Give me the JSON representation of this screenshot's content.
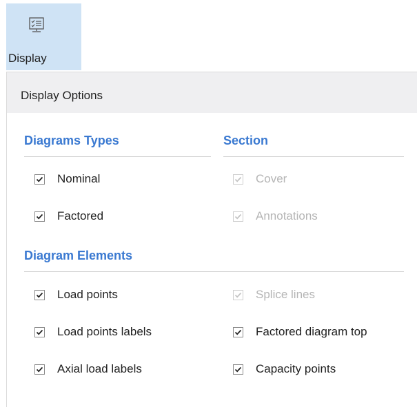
{
  "ribbon": {
    "button_label": "Display",
    "button_icon": "display-options-icon"
  },
  "panel": {
    "title": "Display Options",
    "groups": {
      "diagram_types": {
        "title": "Diagrams Types",
        "items": [
          {
            "label": "Nominal",
            "checked": true,
            "enabled": true
          },
          {
            "label": "Factored",
            "checked": true,
            "enabled": true
          }
        ]
      },
      "section": {
        "title": "Section",
        "items": [
          {
            "label": "Cover",
            "checked": true,
            "enabled": false
          },
          {
            "label": "Annotations",
            "checked": true,
            "enabled": false
          }
        ]
      },
      "diagram_elements": {
        "title": "Diagram Elements",
        "items": [
          {
            "label": "Load points",
            "checked": true,
            "enabled": true
          },
          {
            "label": "Splice lines",
            "checked": true,
            "enabled": false
          },
          {
            "label": "Load points labels",
            "checked": true,
            "enabled": true
          },
          {
            "label": "Factored diagram top",
            "checked": true,
            "enabled": true
          },
          {
            "label": "Axial load labels",
            "checked": true,
            "enabled": true
          },
          {
            "label": "Capacity points",
            "checked": true,
            "enabled": true
          }
        ]
      }
    }
  },
  "colors": {
    "accent": "#3a79d1",
    "ribbon_selected": "#cfe3f5",
    "header_bg": "#efeff1",
    "disabled_text": "#b5b5b5"
  }
}
